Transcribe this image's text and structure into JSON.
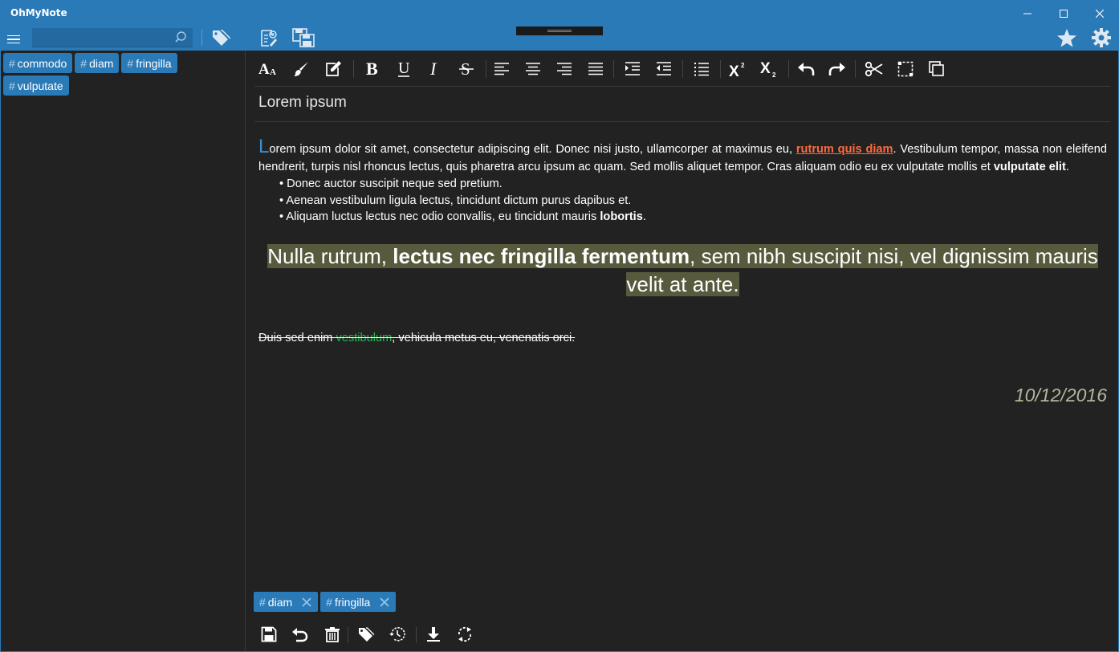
{
  "window": {
    "title": "OhMyNote",
    "controls": [
      "minimize-icon",
      "maximize-icon",
      "close-icon"
    ]
  },
  "topbar": {
    "search": {
      "value": "",
      "placeholder": ""
    },
    "icons": [
      "menu-icon",
      "search-icon",
      "tag-icon",
      "new-note-icon",
      "save-all-icon",
      "favorite-star-icon",
      "settings-gear-icon"
    ]
  },
  "sidebar": {
    "tags": [
      {
        "hash": "#",
        "label": "commodo"
      },
      {
        "hash": "#",
        "label": "diam"
      },
      {
        "hash": "#",
        "label": "fringilla"
      },
      {
        "hash": "#",
        "label": "vulputate"
      }
    ]
  },
  "format_toolbar": {
    "buttons": [
      "font-size-icon",
      "brush-icon",
      "edit-icon",
      "bold-icon",
      "underline-icon",
      "italic-icon",
      "strikethrough-icon",
      "align-left-icon",
      "align-center-icon",
      "align-right-icon",
      "align-justify-icon",
      "indent-icon",
      "outdent-icon",
      "bulleted-list-icon",
      "superscript-icon",
      "subscript-icon",
      "undo-icon",
      "redo-icon",
      "cut-icon",
      "select-all-icon",
      "copy-icon"
    ]
  },
  "note": {
    "title": "Lorem ipsum",
    "p1": {
      "dropcap": "L",
      "t1": "orem ipsum dolor sit amet, consectetur adipiscing elit. Donec nisi justo, ullamcorper at maximus eu, ",
      "link": "rutrum quis diam",
      "t2": ". Vestibulum tempor, massa non eleifend hendrerit, turpis nisl rhoncus lectus, quis pharetra arcu ipsum ac quam. Sed mollis aliquet tempor. Cras aliquam odio eu ex vulputate mollis et ",
      "bold": "vulputate elit",
      "t3": "."
    },
    "bullets": {
      "b1": "Donec auctor suscipit neque sed pretium.",
      "b2": "Aenean vestibulum ligula lectus, tincidunt dictum purus dapibus et.",
      "b3_text": "Aliquam luctus lectus nec odio convallis, eu tincidunt mauris ",
      "b3_bold": "lobortis",
      "b3_end": "."
    },
    "quote": {
      "t1": "Nulla rutrum, ",
      "bold": "lectus nec fringilla fermentum",
      "t2": ", sem nibh suscipit nisi, vel dignissim mauris",
      "t3": "velit at ante."
    },
    "strike": {
      "t1": "Duis sed enim ",
      "green": "vestibulum",
      "t2": ", vehicula metus eu, venenatis orci."
    },
    "date": "10/12/2016",
    "colors": {
      "link": "#ff6a3d",
      "highlight": "#585a3e",
      "green_text": "#28b552",
      "accent": "#2a7ab8",
      "dropcap": "#3a8fd3"
    }
  },
  "note_tags": [
    {
      "hash": "#",
      "label": "diam"
    },
    {
      "hash": "#",
      "label": "fringilla"
    }
  ],
  "bottom_bar": {
    "buttons": [
      "save-icon",
      "revert-icon",
      "delete-icon",
      "tags-icon",
      "history-icon",
      "download-icon",
      "sync-icon"
    ]
  }
}
